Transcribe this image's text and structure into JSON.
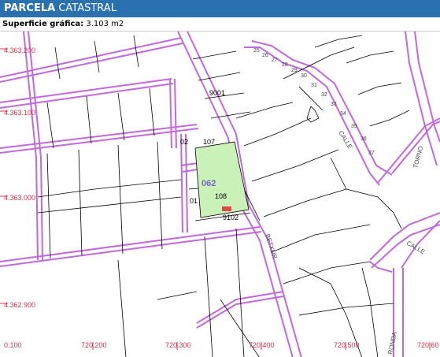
{
  "header": {
    "title_bold": "PARCELA",
    "title_rest": "CATASTRAL"
  },
  "surface": {
    "label": "Superficie gráfica:",
    "value": "3.103 m2"
  },
  "map": {
    "parcel": {
      "code": "062",
      "subparcel_main": "108",
      "subparcel_north": "107",
      "ref_left_top": "02",
      "ref_left_bottom": "01",
      "ref_bottom": "9102",
      "ref_top": "9001"
    },
    "coordinates": {
      "y_labels": [
        "4.363.200",
        "4.363.100",
        "4.363.000",
        "4.362.900"
      ],
      "x_labels": [
        "0.100",
        "720.200",
        "720.300",
        "720.400",
        "720.500",
        "720.60"
      ]
    },
    "streets": {
      "main": "BETXUR",
      "ne_a": "CALLE",
      "ne_b": "TORNO",
      "right_a": "CALLE",
      "bottom_right": "RONDA"
    },
    "colors": {
      "parcel_fill": "#c9f1b8",
      "boundary": "#c268df",
      "line": "#000000",
      "coord_text": "#d9334a",
      "header_bg": "#2a71b0"
    }
  }
}
